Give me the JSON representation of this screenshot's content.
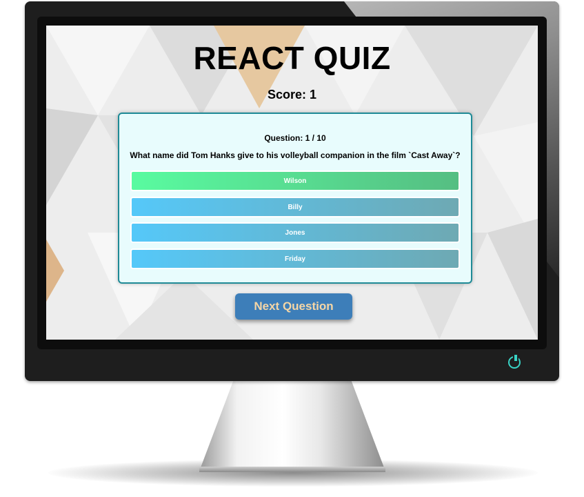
{
  "quiz": {
    "title": "REACT QUIZ",
    "score_text": "Score: 1",
    "question_counter": "Question: 1 / 10",
    "question_text": "What name did Tom Hanks give to his volleyball companion in the film `Cast Away`?",
    "answers": [
      {
        "label": "Wilson",
        "state": "correct"
      },
      {
        "label": "Billy",
        "state": "default"
      },
      {
        "label": "Jones",
        "state": "default"
      },
      {
        "label": "Friday",
        "state": "default"
      }
    ],
    "next_button_label": "Next Question"
  },
  "colors": {
    "card_border": "#1e8a96",
    "card_background": "#e8fcfd",
    "correct_answer": "#59fba0",
    "default_answer": "#55c8f9",
    "next_button": "#3d7eb9",
    "next_button_text": "#f5d6a6",
    "power_led": "#39d4c6"
  },
  "icons": {
    "power": "power-icon"
  }
}
